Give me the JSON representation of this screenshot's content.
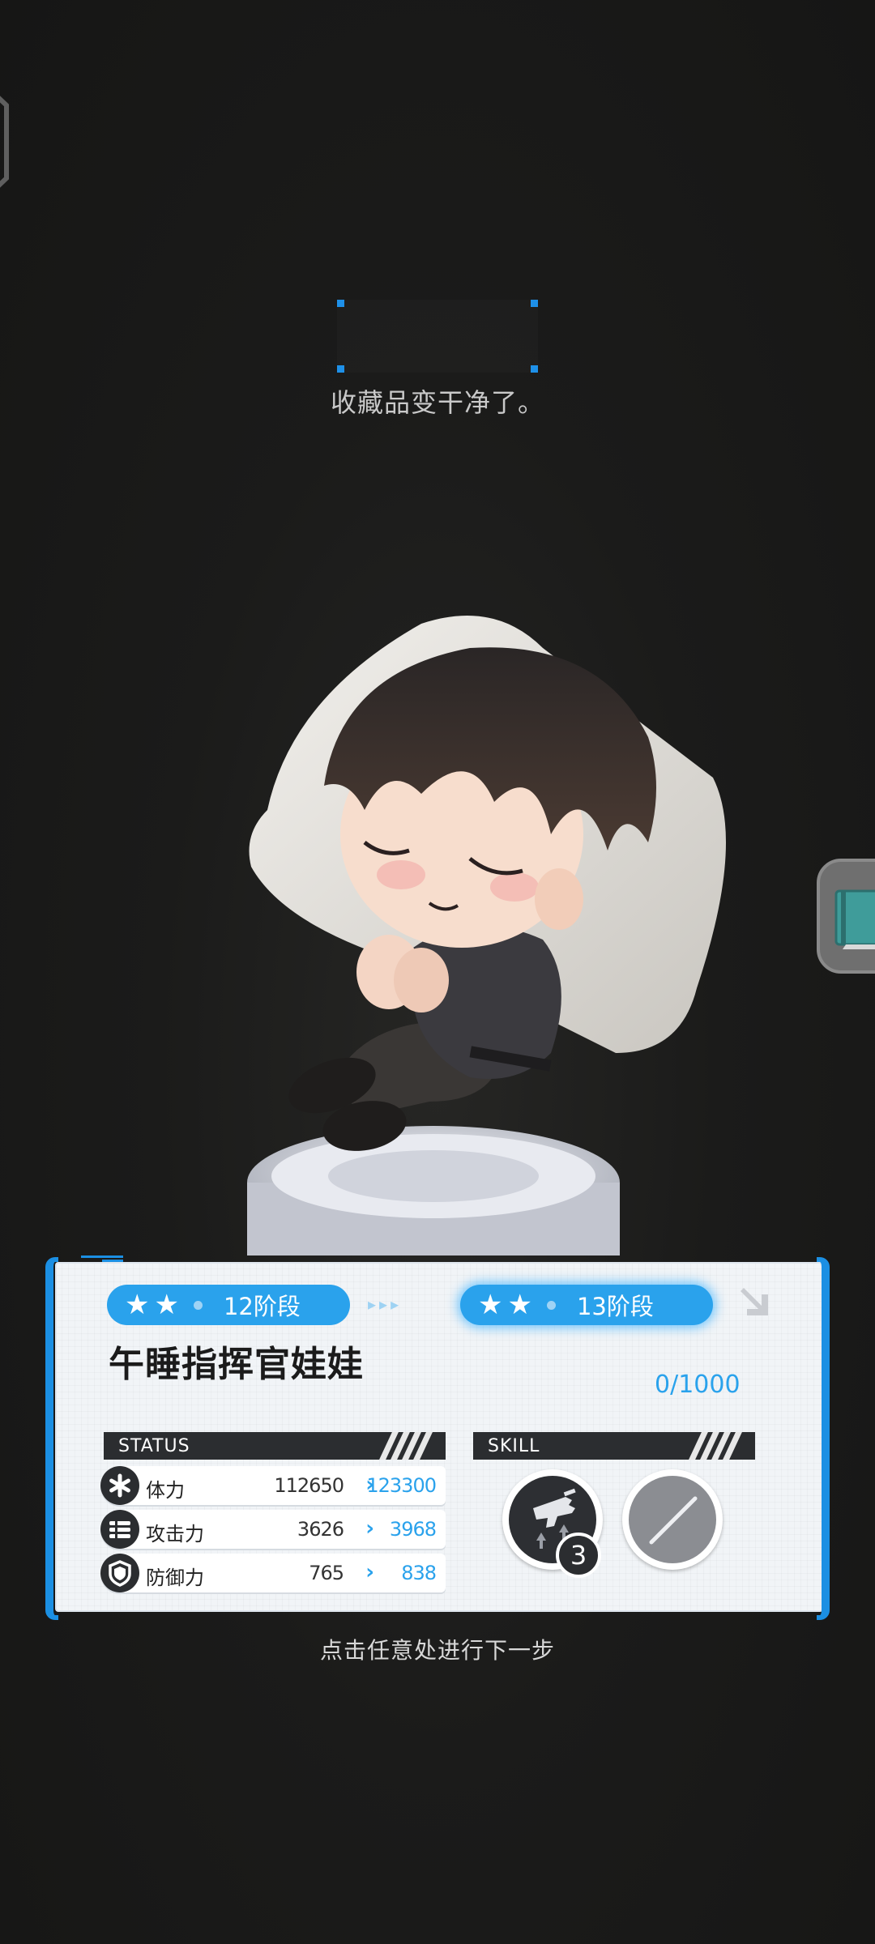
{
  "message": "收藏品变干净了。",
  "card": {
    "current_stage": "12阶段",
    "next_stage": "13阶段",
    "title": "午睡指挥官娃娃",
    "progress": "0/1000",
    "stars_current": 2,
    "stars_next": 2
  },
  "status": {
    "header": "STATUS",
    "rows": [
      {
        "label": "体力",
        "current": "112650",
        "next": "123300",
        "icon": "asterisk-icon"
      },
      {
        "label": "攻击力",
        "current": "3626",
        "next": "3968",
        "icon": "attack-icon"
      },
      {
        "label": "防御力",
        "current": "765",
        "next": "838",
        "icon": "shield-icon"
      }
    ],
    "arrow": "›"
  },
  "skill": {
    "header": "SKILL",
    "skills": [
      {
        "icon": "gun-upgrade-icon",
        "level": "3"
      },
      {
        "icon": "empty-slot-icon"
      }
    ]
  },
  "hint": "点击任意处进行下一步",
  "colors": {
    "accent": "#2aa2ec",
    "frame": "#1b8fe3",
    "dark": "#2b2d30",
    "background": "#1a1a19"
  }
}
